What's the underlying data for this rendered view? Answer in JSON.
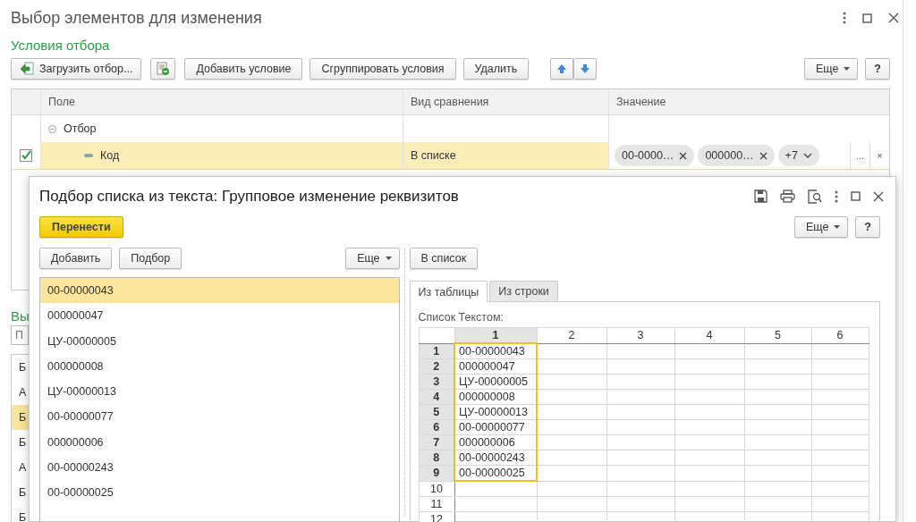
{
  "window": {
    "title": "Выбор элементов для изменения"
  },
  "filter": {
    "title": "Условия отбора",
    "toolbar": [
      {
        "kind": "load",
        "label": "Загрузить отбор..."
      },
      {
        "kind": "report"
      },
      {
        "kind": "text",
        "label": "Добавить условие"
      },
      {
        "kind": "text",
        "label": "Сгруппировать условия"
      },
      {
        "kind": "text",
        "label": "Удалить"
      },
      {
        "kind": "up"
      },
      {
        "kind": "down"
      }
    ],
    "more_button": "Еще",
    "help_button": "?",
    "columns": [
      "Поле",
      "Вид сравнения",
      "Значение"
    ],
    "rows": [
      {
        "kind": "group",
        "field": "Отбор",
        "expanded": true
      },
      {
        "kind": "condition",
        "checked": true,
        "selected": true,
        "field": "Код",
        "comparison": "В списке",
        "values": [
          "00-0000…",
          "000000…"
        ],
        "more": "+7",
        "choose_button": "...",
        "clear_button": "×"
      }
    ]
  },
  "selection": {
    "title": "Вы",
    "search": {
      "placeholder": "П"
    },
    "items": [
      {
        "text": "Б",
        "selected": false
      },
      {
        "text": "А",
        "selected": false
      },
      {
        "text": "Б",
        "selected": true
      },
      {
        "text": "Б",
        "selected": false
      },
      {
        "text": "А",
        "selected": false
      },
      {
        "text": "Б",
        "selected": false
      },
      {
        "text": "Б",
        "selected": false
      }
    ]
  },
  "dialog": {
    "title": "Подбор списка из текста: Групповое изменение реквизитов",
    "primary_button": "Перенести",
    "more_button": "Еще",
    "help_button": "?",
    "left_toolbar": [
      "Добавить",
      "Подбор"
    ],
    "left_more": "Еще",
    "list": [
      {
        "text": "00-00000043",
        "selected": true
      },
      {
        "text": "000000047",
        "selected": false
      },
      {
        "text": "ЦУ-00000005",
        "selected": false
      },
      {
        "text": "000000008",
        "selected": false
      },
      {
        "text": "ЦУ-00000013",
        "selected": false
      },
      {
        "text": "00-00000077",
        "selected": false
      },
      {
        "text": "000000006",
        "selected": false
      },
      {
        "text": "00-00000243",
        "selected": false
      },
      {
        "text": "00-00000025",
        "selected": false
      }
    ],
    "to_list_button": "В список",
    "tabs": [
      {
        "label": "Из таблицы",
        "selected": true
      },
      {
        "label": "Из строки",
        "selected": false
      }
    ],
    "grid_label": "Список Текстом:",
    "grid": {
      "columns": [
        {
          "label": "1",
          "selected": true
        },
        {
          "label": "2",
          "selected": false
        },
        {
          "label": "3",
          "selected": false
        },
        {
          "label": "4",
          "selected": false
        },
        {
          "label": "5",
          "selected": false
        },
        {
          "label": "6",
          "selected": false
        }
      ],
      "rows": [
        {
          "label": "1",
          "value": "00-00000043",
          "selected": true
        },
        {
          "label": "2",
          "value": "000000047",
          "selected": true
        },
        {
          "label": "3",
          "value": "ЦУ-00000005",
          "selected": true
        },
        {
          "label": "4",
          "value": "000000008",
          "selected": true
        },
        {
          "label": "5",
          "value": "ЦУ-00000013",
          "selected": true
        },
        {
          "label": "6",
          "value": "00-00000077",
          "selected": true
        },
        {
          "label": "7",
          "value": "000000006",
          "selected": true
        },
        {
          "label": "8",
          "value": "00-00000243",
          "selected": true
        },
        {
          "label": "9",
          "value": "00-00000025",
          "selected": true
        },
        {
          "label": "10",
          "selected": false
        },
        {
          "label": "11",
          "selected": false
        },
        {
          "label": "12",
          "selected": false
        }
      ]
    }
  }
}
